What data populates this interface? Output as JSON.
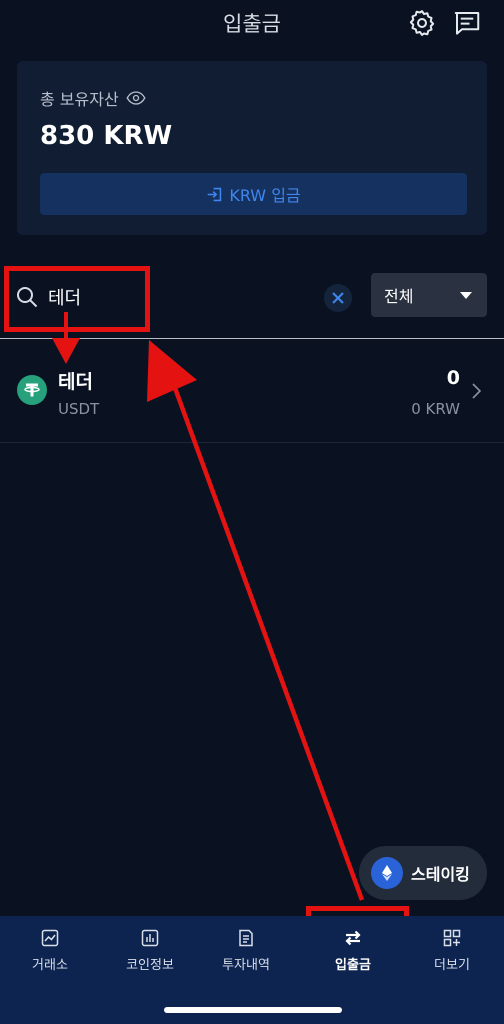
{
  "header": {
    "title": "입출금",
    "settings_icon": "gear-icon",
    "notice_icon": "message-icon"
  },
  "asset": {
    "label": "총 보유자산",
    "amount": "830 KRW",
    "deposit_label": "KRW 입금"
  },
  "search": {
    "value": "테더",
    "filter_selected": "전체"
  },
  "coins": [
    {
      "name": "테더",
      "symbol": "USDT",
      "quantity": "0",
      "krw_value": "0 KRW",
      "logo_color": "#26a17b"
    }
  ],
  "staking": {
    "label": "스테이킹"
  },
  "tabs": [
    {
      "label": "거래소",
      "icon": "chart-line-icon"
    },
    {
      "label": "코인정보",
      "icon": "bar-chart-icon"
    },
    {
      "label": "투자내역",
      "icon": "document-icon"
    },
    {
      "label": "입출금",
      "icon": "transfer-icon",
      "active": true
    },
    {
      "label": "더보기",
      "icon": "grid-plus-icon"
    }
  ],
  "colors": {
    "background": "#0a1222",
    "accent": "#3f86ef",
    "tabbar": "#0d2350",
    "annotation": "#e51212"
  }
}
